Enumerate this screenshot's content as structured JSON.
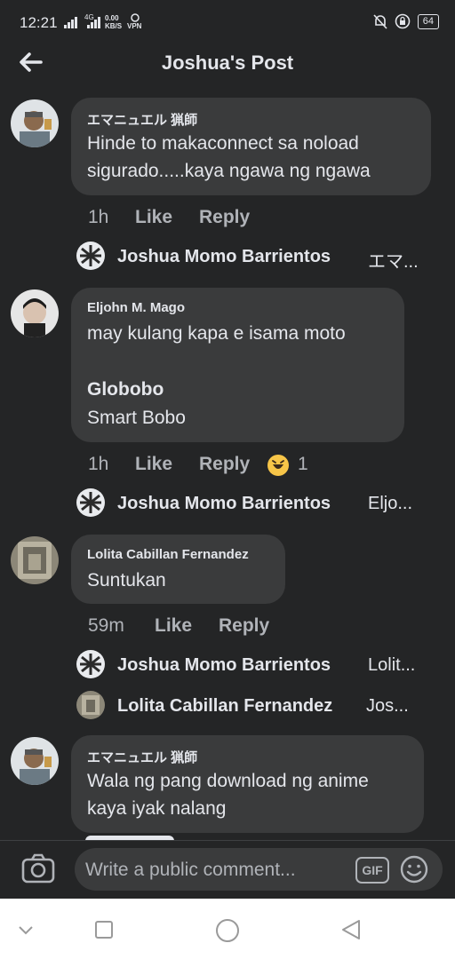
{
  "status_bar": {
    "time": "12:21",
    "network_label": "4G",
    "speed_value": "0.00",
    "speed_unit": "KB/S",
    "vpn": "VPN",
    "battery": "64"
  },
  "header": {
    "title": "Joshua's Post"
  },
  "comments": [
    {
      "author": "エマニュエル 猟師",
      "lines": [
        "Hinde to makaconnect sa noload",
        "sigurado.....kaya ngawa ng ngawa"
      ],
      "time": "1h",
      "like_label": "Like",
      "reply_label": "Reply",
      "replies": [
        {
          "name": "Joshua Momo Barrientos",
          "preview": "エマ..."
        }
      ]
    },
    {
      "author": "Eljohn M. Mago",
      "lines": [
        "may kulang kapa e isama moto",
        "",
        "Globobo",
        "Smart Bobo"
      ],
      "time": "1h",
      "like_label": "Like",
      "reply_label": "Reply",
      "reaction_count": "1",
      "replies": [
        {
          "name": "Joshua Momo Barrientos",
          "preview": "Eljo..."
        }
      ]
    },
    {
      "author": "Lolita Cabillan Fernandez",
      "lines": [
        "Suntukan"
      ],
      "time": "59m",
      "like_label": "Like",
      "reply_label": "Reply",
      "replies": [
        {
          "name": "Joshua Momo Barrientos",
          "preview": "Lolit..."
        },
        {
          "name": "Lolita Cabillan Fernandez",
          "preview": "Jos..."
        }
      ]
    },
    {
      "author": "エマニュエル 猟師",
      "lines": [
        "Wala ng pang download ng anime",
        "kaya iyak nalang"
      ]
    }
  ],
  "composer": {
    "placeholder": "Write a public comment...",
    "gif_label": "GIF"
  }
}
